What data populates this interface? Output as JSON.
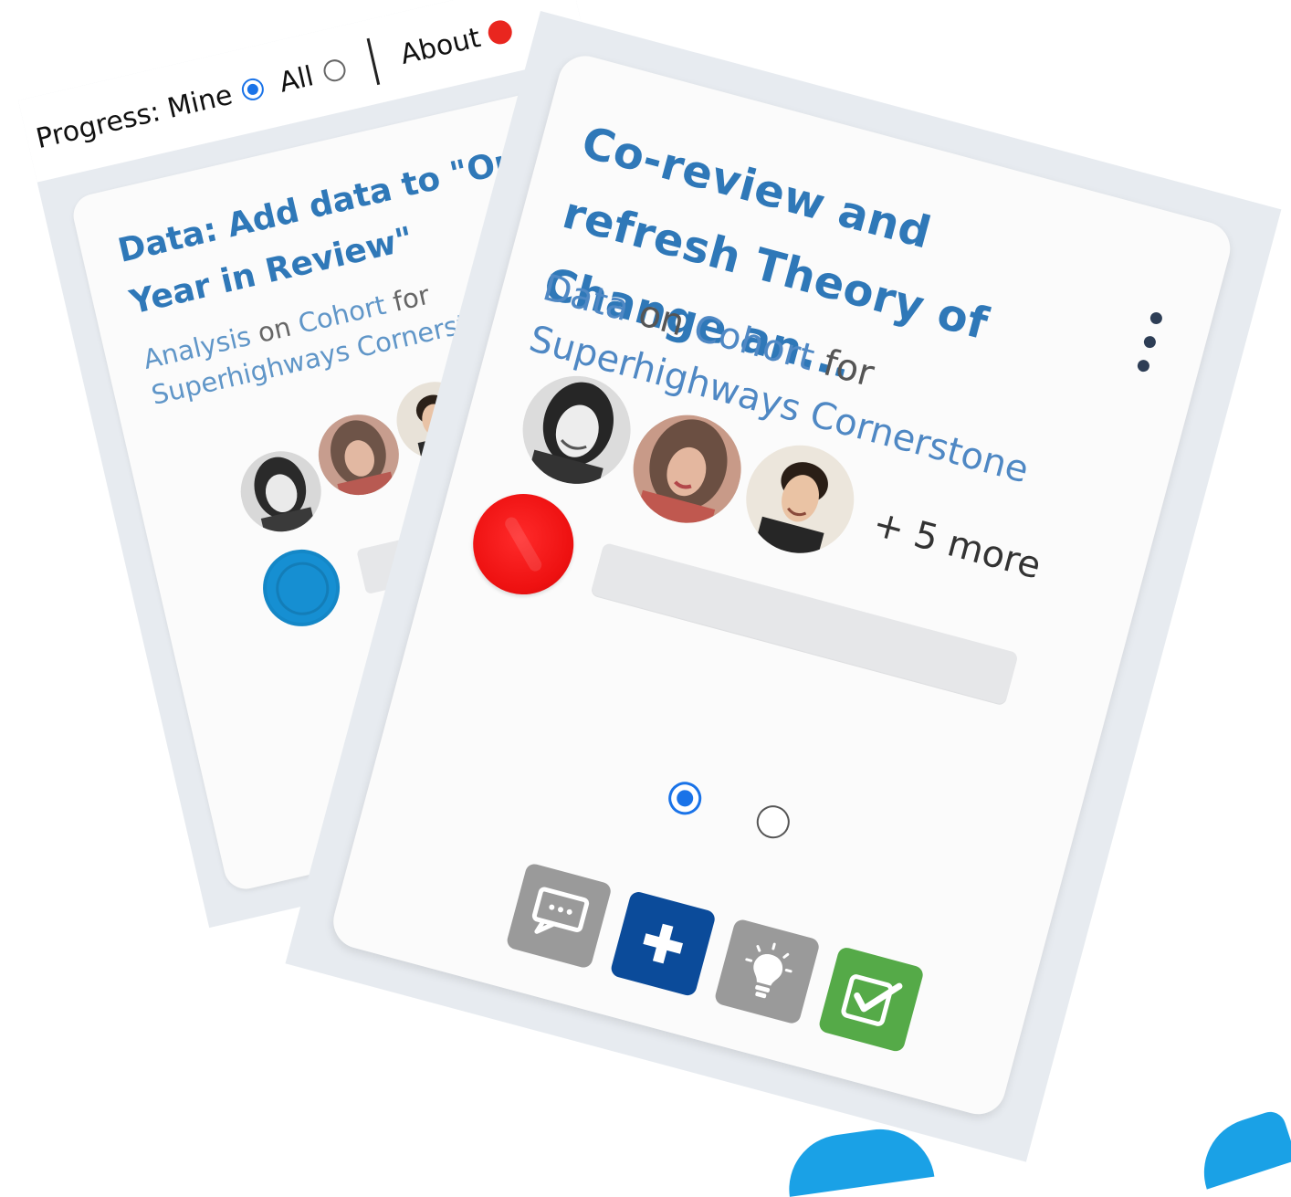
{
  "filter_bar": {
    "progress_label": "Progress: Mine",
    "all_label": "All",
    "about_label": "About",
    "mine_selected": true
  },
  "back_card": {
    "title": "Data: Add data to \"Our Year in Review\"",
    "subtitle": {
      "part1": "Analysis",
      "part2": " on ",
      "part3": "Cohort",
      "part4": " for ",
      "part5": "Superhighways Cornerstone"
    },
    "status_color": "#168fd2"
  },
  "front_card": {
    "title": "Co-review and refresh Theory of Change an...",
    "subtitle": {
      "part1": "Data",
      "part2": " on ",
      "part3": "Cohort",
      "part4": " for ",
      "part5": "Superhighways Cornerstone"
    },
    "more_members": "+ 5 more",
    "status_color": "#ee1111",
    "pager": {
      "pages": 2,
      "current": 1
    },
    "actions": [
      {
        "name": "comment-icon",
        "color": "#9a9a9a"
      },
      {
        "name": "plus-icon",
        "color": "#0b4b9a"
      },
      {
        "name": "lightbulb-icon",
        "color": "#9a9a9a"
      },
      {
        "name": "checkbox-icon",
        "color": "#55aa48"
      }
    ]
  }
}
